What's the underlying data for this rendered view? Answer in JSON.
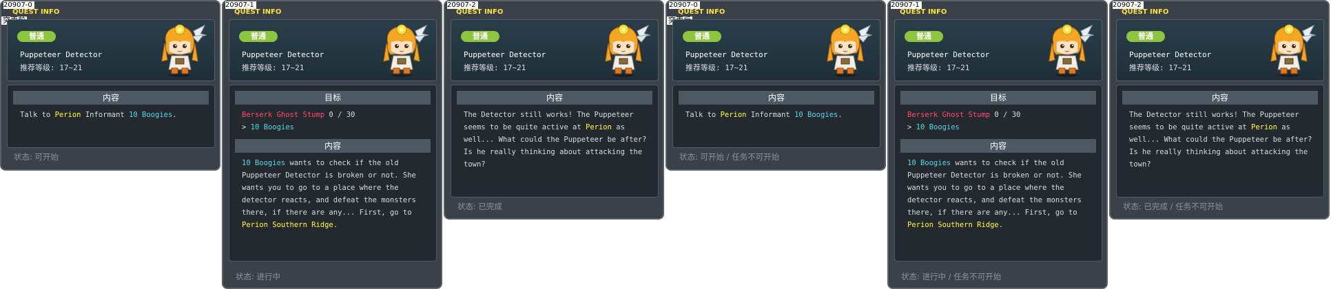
{
  "panels": [
    {
      "id": "20907-0",
      "title": "QUEST INFO",
      "note": "突更前",
      "badge": "普通",
      "npc": "Puppeteer Detector",
      "level": "推荐等级: 17~21",
      "section": "内容",
      "content": [
        "Talk to ",
        {
          "t": "Perion",
          "c": "y"
        },
        " Informant ",
        {
          "t": "10 Boogies",
          "c": "c"
        },
        "."
      ],
      "status": "状态: 可开始"
    },
    {
      "id": "20907-1",
      "title": "QUEST INFO",
      "badge": "普通",
      "npc": "Puppeteer Detector",
      "level": "推荐等级: 17~21",
      "goal_head": "目标",
      "goal_monster": "Berserk Ghost Stump",
      "goal_count": " 0 / 30",
      "goal_sub_prefix": "> ",
      "goal_sub": "10 Boogies",
      "section": "内容",
      "content": [
        {
          "t": "10 Boogies",
          "c": "c"
        },
        " wants to check if the old Puppeteer Detector is broken or not. She wants you to go to a place where the detector reacts, and defeat the monsters there, if there are any... First, go to ",
        {
          "t": "Perion Southern Ridge",
          "c": "y"
        },
        "."
      ],
      "status": "状态: 进行中"
    },
    {
      "id": "20907-2",
      "title": "QUEST INFO",
      "badge": "普通",
      "npc": "Puppeteer Detector",
      "level": "推荐等级: 17~21",
      "section": "内容",
      "content": [
        "The Detector still works! The Puppeteer seems to be quite active at ",
        {
          "t": "Perion",
          "c": "y"
        },
        " as well... What could the Puppeteer be after? Is he really thinking about attacking the town?"
      ],
      "status": "状态: 已完成"
    },
    {
      "id": "20907-0",
      "title": "QUEST INFO",
      "note": "突更后",
      "badge": "普通",
      "npc": "Puppeteer Detector",
      "level": "推荐等级: 17~21",
      "section": "内容",
      "content": [
        "Talk to ",
        {
          "t": "Perion",
          "c": "y"
        },
        " Informant ",
        {
          "t": "10 Boogies",
          "c": "c"
        },
        "."
      ],
      "status": "状态: 可开始 / 任务不可开始"
    },
    {
      "id": "20907-1",
      "title": "QUEST INFO",
      "badge": "普通",
      "npc": "Puppeteer Detector",
      "level": "推荐等级: 17~21",
      "goal_head": "目标",
      "goal_monster": "Berserk Ghost Stump",
      "goal_count": " 0 / 30",
      "goal_sub_prefix": "> ",
      "goal_sub": "10 Boogies",
      "section": "内容",
      "content": [
        {
          "t": "10 Boogies",
          "c": "c"
        },
        " wants to check if the old Puppeteer Detector is broken or not. She wants you to go to a place where the detector reacts, and defeat the monsters there, if there are any... First, go to ",
        {
          "t": "Perion Southern Ridge",
          "c": "y"
        },
        "."
      ],
      "status": "状态: 进行中 / 任务不可开始"
    },
    {
      "id": "20907-2",
      "title": "QUEST INFO",
      "badge": "普通",
      "npc": "Puppeteer Detector",
      "level": "推荐等级: 17~21",
      "section": "内容",
      "content": [
        "The Detector still works! The Puppeteer seems to be quite active at ",
        {
          "t": "Perion",
          "c": "y"
        },
        " as well... What could the Puppeteer be after? Is he really thinking about attacking the town?"
      ],
      "status": "状态: 已完成 / 任务不可开始"
    }
  ],
  "colors": {
    "accent_yellow": "#ffff33",
    "accent_cyan": "#55d8e8",
    "monster_red": "#ff4a6a",
    "badge_green": "#8cc63f",
    "panel_bg": "#3a4148"
  }
}
